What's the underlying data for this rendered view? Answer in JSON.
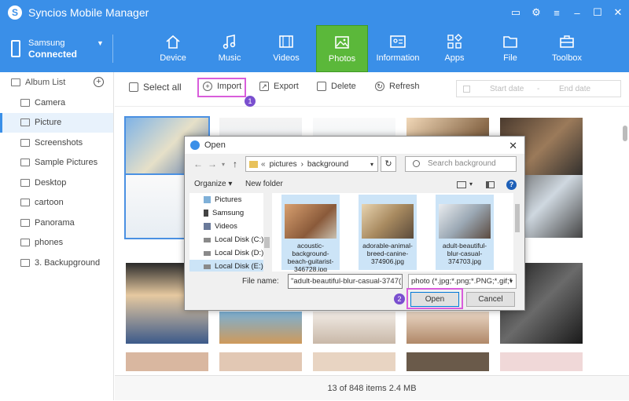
{
  "app": {
    "title": "Syncios Mobile Manager"
  },
  "device": {
    "name": "Samsung",
    "status": "Connected"
  },
  "nav": [
    {
      "label": "Device"
    },
    {
      "label": "Music"
    },
    {
      "label": "Videos"
    },
    {
      "label": "Photos"
    },
    {
      "label": "Information"
    },
    {
      "label": "Apps"
    },
    {
      "label": "File"
    },
    {
      "label": "Toolbox"
    }
  ],
  "sidebar": {
    "header": "Album List",
    "albums": [
      "Camera",
      "Picture",
      "Screenshots",
      "Sample Pictures",
      "Desktop",
      "cartoon",
      "Panorama",
      "phones",
      "3. Backupground"
    ]
  },
  "actions": {
    "select_all": "Select all",
    "import": "Import",
    "export": "Export",
    "delete": "Delete",
    "refresh": "Refresh",
    "start_date": "Start date",
    "end_date": "End date",
    "date_sep": "-"
  },
  "badges": {
    "one": "1",
    "two": "2"
  },
  "status": "13 of 848 items 2.4 MB",
  "dialog": {
    "title": "Open",
    "path": [
      "«",
      "pictures",
      "›",
      "background"
    ],
    "search_placeholder": "Search background",
    "organize": "Organize ▾",
    "new_folder": "New folder",
    "help": "?",
    "tree": [
      "Pictures",
      "Samsung",
      "Videos",
      "Local Disk (C:)",
      "Local Disk (D:)",
      "Local Disk (E:)"
    ],
    "files": [
      "acoustic-background-beach-guitarist-346728.jpg",
      "adorable-animal-breed-canine-374906.jpg",
      "adult-beautiful-blur-casual-374703.jpg"
    ],
    "filename_label": "File name:",
    "filename_value": "\"adult-beautiful-blur-casual-3747(",
    "filetype": "photo (*.jpg;*.png;*.PNG;*.gif;*",
    "open": "Open",
    "cancel": "Cancel"
  },
  "colors": {
    "accent": "#3a8fe8",
    "active_nav": "#5bb83a",
    "highlight": "#d95ddb",
    "badge": "#7a4fcf"
  }
}
